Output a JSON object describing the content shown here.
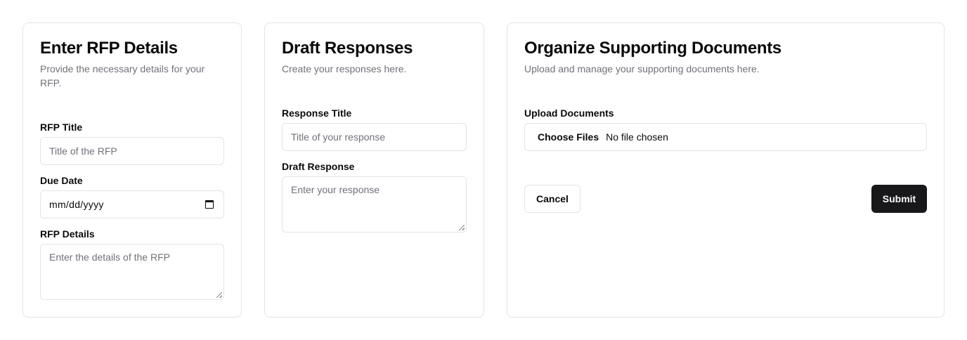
{
  "rfp_card": {
    "title": "Enter RFP Details",
    "description": "Provide the necessary details for your RFP.",
    "rfp_title_label": "RFP Title",
    "rfp_title_placeholder": "Title of the RFP",
    "due_date_label": "Due Date",
    "due_date_value": "mm/dd/yyyy",
    "rfp_details_label": "RFP Details",
    "rfp_details_placeholder": "Enter the details of the RFP"
  },
  "draft_card": {
    "title": "Draft Responses",
    "description": "Create your responses here.",
    "response_title_label": "Response Title",
    "response_title_placeholder": "Title of your response",
    "draft_response_label": "Draft Response",
    "draft_response_placeholder": "Enter your response"
  },
  "docs_card": {
    "title": "Organize Supporting Documents",
    "description": "Upload and manage your supporting documents here.",
    "upload_label": "Upload Documents",
    "choose_files_label": "Choose Files",
    "no_file_text": "No file chosen",
    "cancel_label": "Cancel",
    "submit_label": "Submit"
  },
  "icons": {
    "calendar": "calendar-icon",
    "resize": "resize-grip-icon"
  },
  "colors": {
    "primary_button": "#18181b",
    "border": "#e4e4e7",
    "muted_text": "#71717a"
  }
}
